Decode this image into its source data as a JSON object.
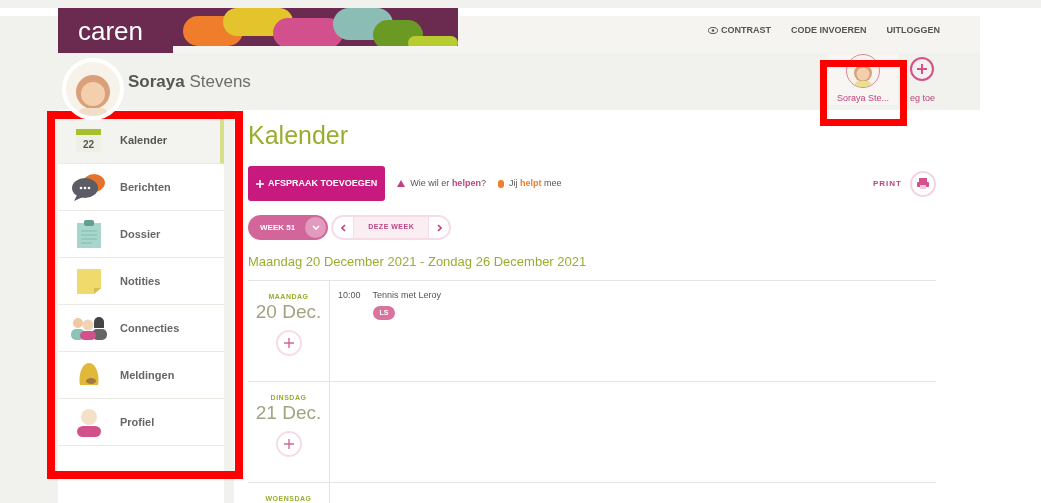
{
  "brand": {
    "logo": "caren"
  },
  "top_links": [
    {
      "label": "CONTRAST",
      "kind": "contrast"
    },
    {
      "label": "CODE INVOEREN",
      "kind": "plain"
    },
    {
      "label": "UITLOGGEN",
      "kind": "plain"
    }
  ],
  "user": {
    "first_name": "Soraya",
    "last_name": "Stevens"
  },
  "switcher": [
    {
      "label": "Soraya Ste...",
      "kind": "avatar",
      "selected": true
    },
    {
      "label": "eg toe",
      "kind": "add",
      "selected": false
    }
  ],
  "sidebar": {
    "items": [
      {
        "label": "Kalender",
        "kind": "calendar",
        "badge": "22",
        "selected": true
      },
      {
        "label": "Berichten",
        "kind": "chat",
        "selected": false
      },
      {
        "label": "Dossier",
        "kind": "clipboard",
        "selected": false
      },
      {
        "label": "Notities",
        "kind": "note",
        "selected": false
      },
      {
        "label": "Connecties",
        "kind": "people",
        "selected": false
      },
      {
        "label": "Meldingen",
        "kind": "bell",
        "selected": false
      },
      {
        "label": "Profiel",
        "kind": "profile",
        "selected": false
      }
    ]
  },
  "main": {
    "title": "Kalender",
    "add_button": "AFSPRAAK TOEVOEGEN",
    "legend": [
      {
        "kind": "triangle",
        "text": "Wie wil er **helpen**?",
        "color": "#c0437f"
      },
      {
        "kind": "dot",
        "text": "Jij **helpt** mee",
        "color": "#ef7d2b"
      }
    ],
    "print": "PRINT",
    "week_select": "WEEK 51",
    "this_week": "DEZE WEEK",
    "range": "Maandag 20 December 2021 - Zondag 26 December 2021",
    "days": [
      {
        "weekday": "MAANDAG",
        "date": "20 Dec.",
        "events": [
          {
            "time": "10:00",
            "title": "Tennis met Leroy",
            "tag": "LS"
          }
        ]
      },
      {
        "weekday": "DINSDAG",
        "date": "21 Dec."
      },
      {
        "weekday": "WOENSDAG"
      }
    ]
  }
}
